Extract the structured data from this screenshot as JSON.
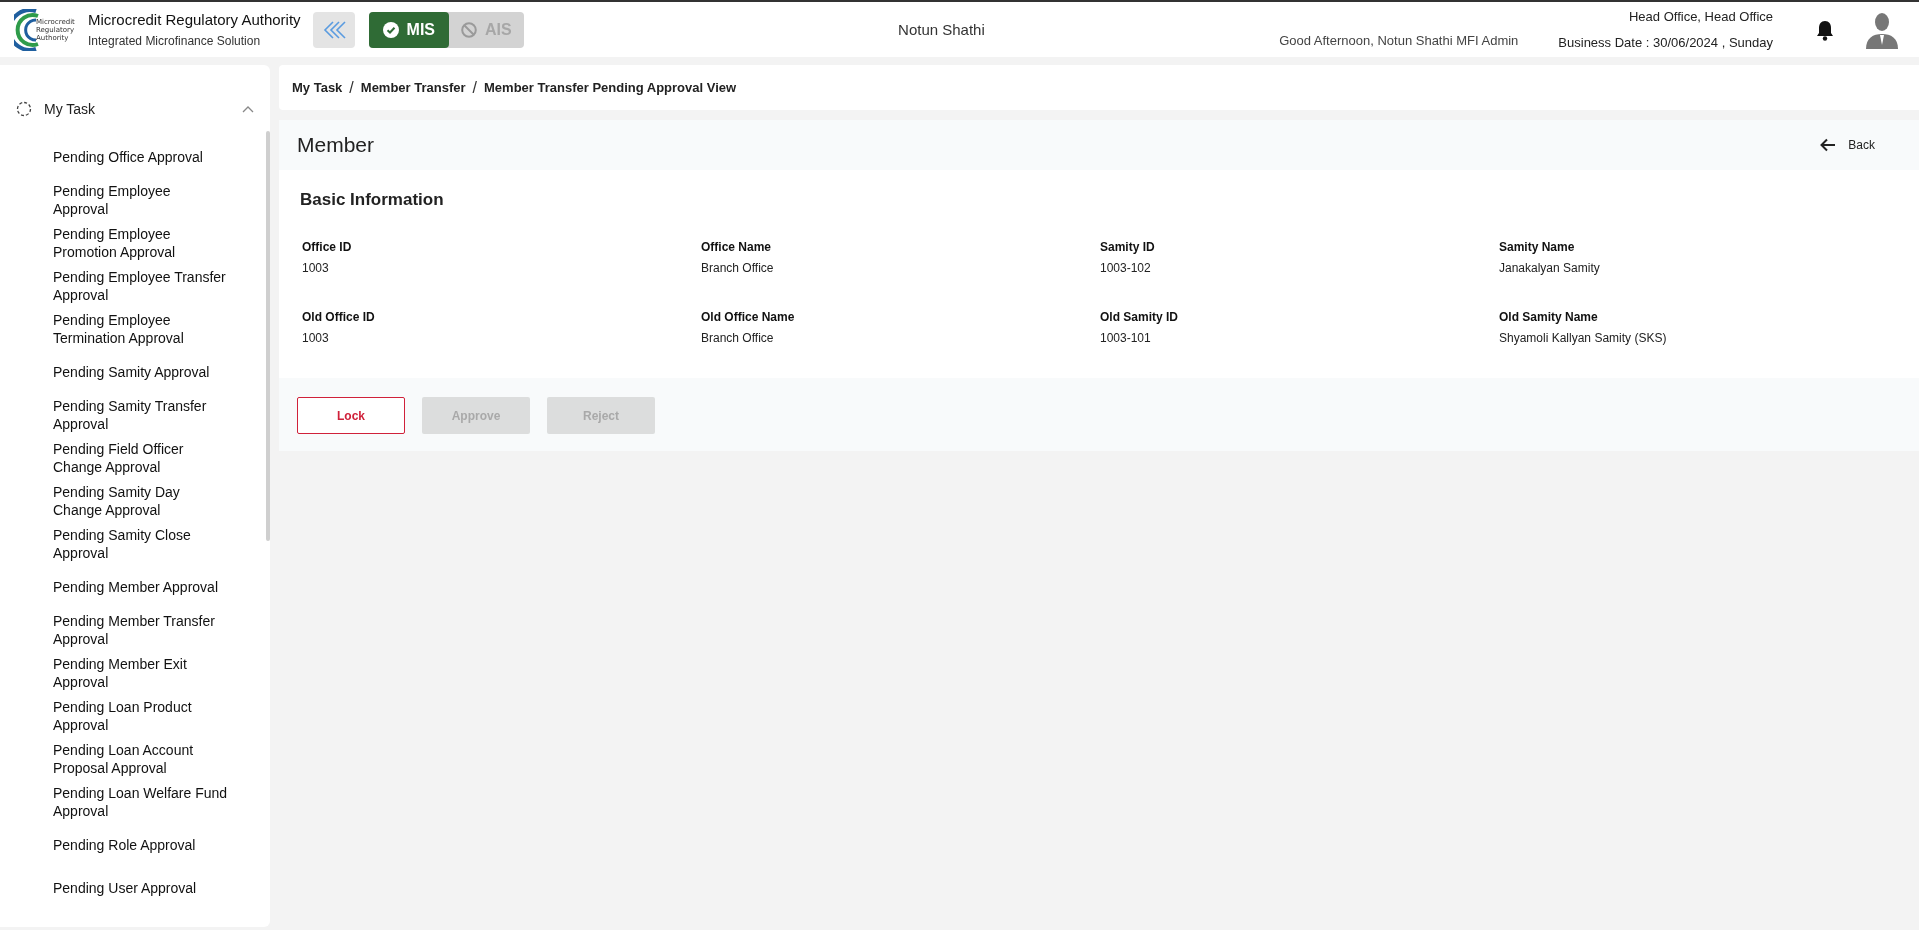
{
  "header": {
    "org_name": "Microcredit Regulatory Authority",
    "org_subtitle": "Integrated Microfinance Solution",
    "logo_text": "Microcredit\nRegulatory\nAuthority",
    "modes": [
      {
        "label": "MIS",
        "selected": true
      },
      {
        "label": "AIS",
        "selected": false
      }
    ],
    "center_title": "Notun Shathi",
    "greeting": "Good Afternoon, Notun Shathi MFI Admin",
    "office": "Head Office, Head Office",
    "business_date": "Business Date : 30/06/2024 , Sunday"
  },
  "sidebar": {
    "section": {
      "label": "My Task",
      "expanded": true
    },
    "items": [
      {
        "label": "Pending Office Approval"
      },
      {
        "label": "Pending Employee\nApproval"
      },
      {
        "label": "Pending Employee\nPromotion Approval"
      },
      {
        "label": "Pending Employee Transfer\nApproval"
      },
      {
        "label": "Pending Employee\nTermination Approval"
      },
      {
        "label": "Pending Samity Approval"
      },
      {
        "label": "Pending Samity Transfer\nApproval"
      },
      {
        "label": "Pending Field Officer\nChange Approval"
      },
      {
        "label": "Pending Samity Day\nChange Approval"
      },
      {
        "label": "Pending Samity Close\nApproval"
      },
      {
        "label": "Pending Member Approval"
      },
      {
        "label": "Pending Member Transfer\nApproval"
      },
      {
        "label": "Pending Member Exit\nApproval"
      },
      {
        "label": "Pending Loan Product\nApproval"
      },
      {
        "label": "Pending Loan Account\nProposal Approval"
      },
      {
        "label": "Pending Loan Welfare Fund\nApproval"
      },
      {
        "label": "Pending Role Approval"
      },
      {
        "label": "Pending User Approval"
      }
    ]
  },
  "breadcrumb_separator": "/",
  "breadcrumb": [
    "My Task",
    "Member Transfer",
    "Member Transfer Pending Approval View"
  ],
  "page_title": "Member",
  "back_label": "Back",
  "section_title": "Basic Information",
  "fields": [
    {
      "label": "Office ID",
      "value": "1003"
    },
    {
      "label": "Office Name",
      "value": "Branch Office"
    },
    {
      "label": "Samity ID",
      "value": "1003-102"
    },
    {
      "label": "Samity Name",
      "value": "Janakalyan Samity"
    },
    {
      "label": "Old Office ID",
      "value": "1003"
    },
    {
      "label": "Old Office Name",
      "value": "Branch Office"
    },
    {
      "label": "Old Samity ID",
      "value": "1003-101"
    },
    {
      "label": "Old Samity Name",
      "value": "Shyamoli Kallyan Samity (SKS)"
    }
  ],
  "buttons": [
    {
      "label": "Lock",
      "disabled": false
    },
    {
      "label": "Approve",
      "disabled": true
    },
    {
      "label": "Reject",
      "disabled": true
    }
  ]
}
